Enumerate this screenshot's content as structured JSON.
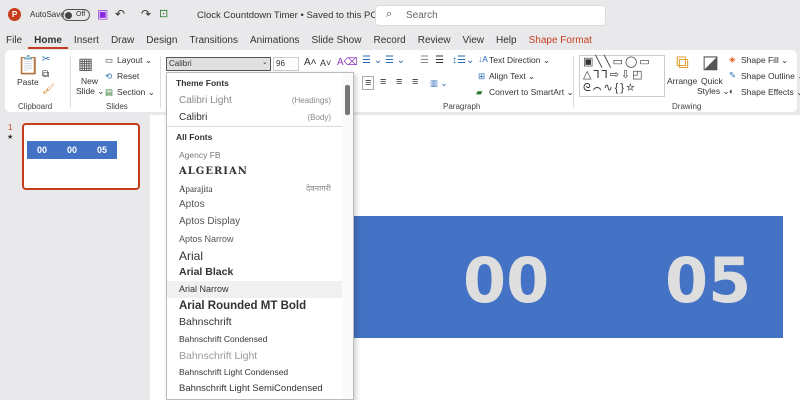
{
  "titlebar": {
    "autosave_label": "AutoSave",
    "autosave_state": "Off",
    "doc_title": "Clock Countdown Timer • Saved to this PC ⌄",
    "search_placeholder": "Search"
  },
  "tabs": [
    "File",
    "Home",
    "Insert",
    "Draw",
    "Design",
    "Transitions",
    "Animations",
    "Slide Show",
    "Record",
    "Review",
    "View",
    "Help",
    "Shape Format"
  ],
  "active_tab": "Home",
  "ribbon": {
    "clipboard": {
      "label": "Clipboard",
      "paste": "Paste"
    },
    "slides": {
      "label": "Slides",
      "new_slide": "New",
      "new_slide2": "Slide ⌄",
      "layout": "Layout ⌄",
      "reset": "Reset",
      "section": "Section ⌄"
    },
    "font": {
      "font_name": "Calibri",
      "font_size": "96"
    },
    "paragraph": {
      "label": "Paragraph",
      "text_direction": "Text Direction ⌄",
      "align_text": "Align Text ⌄",
      "convert_smartart": "Convert to SmartArt ⌄"
    },
    "drawing": {
      "label": "Drawing",
      "arrange": "Arrange",
      "quick_styles": "Quick",
      "quick_styles2": "Styles ⌄",
      "shape_fill": "Shape Fill ⌄",
      "shape_outline": "Shape Outline ⌄",
      "shape_effects": "Shape Effects ⌄"
    }
  },
  "font_dropdown": {
    "theme_header": "Theme Fonts",
    "theme_fonts": [
      {
        "name": "Calibri Light",
        "hint": "(Headings)"
      },
      {
        "name": "Calibri",
        "hint": "(Body)"
      }
    ],
    "all_header": "All Fonts",
    "all_fonts": [
      {
        "name": "Agency FB",
        "hint": ""
      },
      {
        "name": "ALGERIAN",
        "hint": ""
      },
      {
        "name": "Aparajita",
        "hint": "देवनागरी"
      },
      {
        "name": "Aptos",
        "hint": ""
      },
      {
        "name": "Aptos Display",
        "hint": ""
      },
      {
        "name": "Aptos Narrow",
        "hint": ""
      },
      {
        "name": "Arial",
        "hint": ""
      },
      {
        "name": "Arial Black",
        "hint": ""
      },
      {
        "name": "Arial Narrow",
        "hint": ""
      },
      {
        "name": "Arial Rounded MT Bold",
        "hint": ""
      },
      {
        "name": "Bahnschrift",
        "hint": ""
      },
      {
        "name": "Bahnschrift Condensed",
        "hint": ""
      },
      {
        "name": "Bahnschrift Light",
        "hint": ""
      },
      {
        "name": "Bahnschrift Light Condensed",
        "hint": ""
      },
      {
        "name": "Bahnschrift Light SemiCondensed",
        "hint": ""
      }
    ],
    "hovered": "Arial Narrow"
  },
  "thumbnail": {
    "number": "1",
    "star": "★",
    "values": [
      "00",
      "00",
      "05"
    ]
  },
  "slide": {
    "values": [
      "00",
      "05"
    ]
  },
  "colors": {
    "accent": "#c43e1c",
    "timer_bar": "#4472c4",
    "timer_text": "#dedede"
  }
}
